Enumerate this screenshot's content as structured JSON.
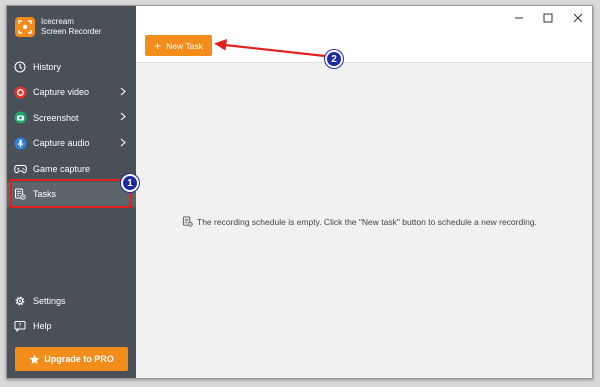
{
  "app": {
    "brand_line1": "Icecream",
    "brand_line2": "Screen Recorder"
  },
  "sidebar": {
    "items": [
      {
        "label": "History",
        "icon": "clock-icon",
        "has_submenu": false
      },
      {
        "label": "Capture video",
        "icon": "record-icon",
        "has_submenu": true
      },
      {
        "label": "Screenshot",
        "icon": "camera-icon",
        "has_submenu": true
      },
      {
        "label": "Capture audio",
        "icon": "microphone-icon",
        "has_submenu": true
      },
      {
        "label": "Game capture",
        "icon": "gamepad-icon",
        "has_submenu": false
      },
      {
        "label": "Tasks",
        "icon": "tasks-icon",
        "has_submenu": false,
        "active": true
      }
    ],
    "bottom_items": [
      {
        "label": "Settings",
        "icon": "gear-icon"
      },
      {
        "label": "Help",
        "icon": "help-icon"
      }
    ],
    "upgrade_label": "Upgrade to PRO"
  },
  "main": {
    "new_task_label": "New Task",
    "empty_message": "The recording schedule is empty. Click the \"New task\" button to schedule a new recording."
  },
  "annotations": {
    "badge1": "1",
    "badge2": "2"
  },
  "colors": {
    "accent": "#f28c1b",
    "sidebar_bg": "#4a5058",
    "highlight_red": "#e2211c",
    "badge_blue": "#1c2aa8"
  }
}
